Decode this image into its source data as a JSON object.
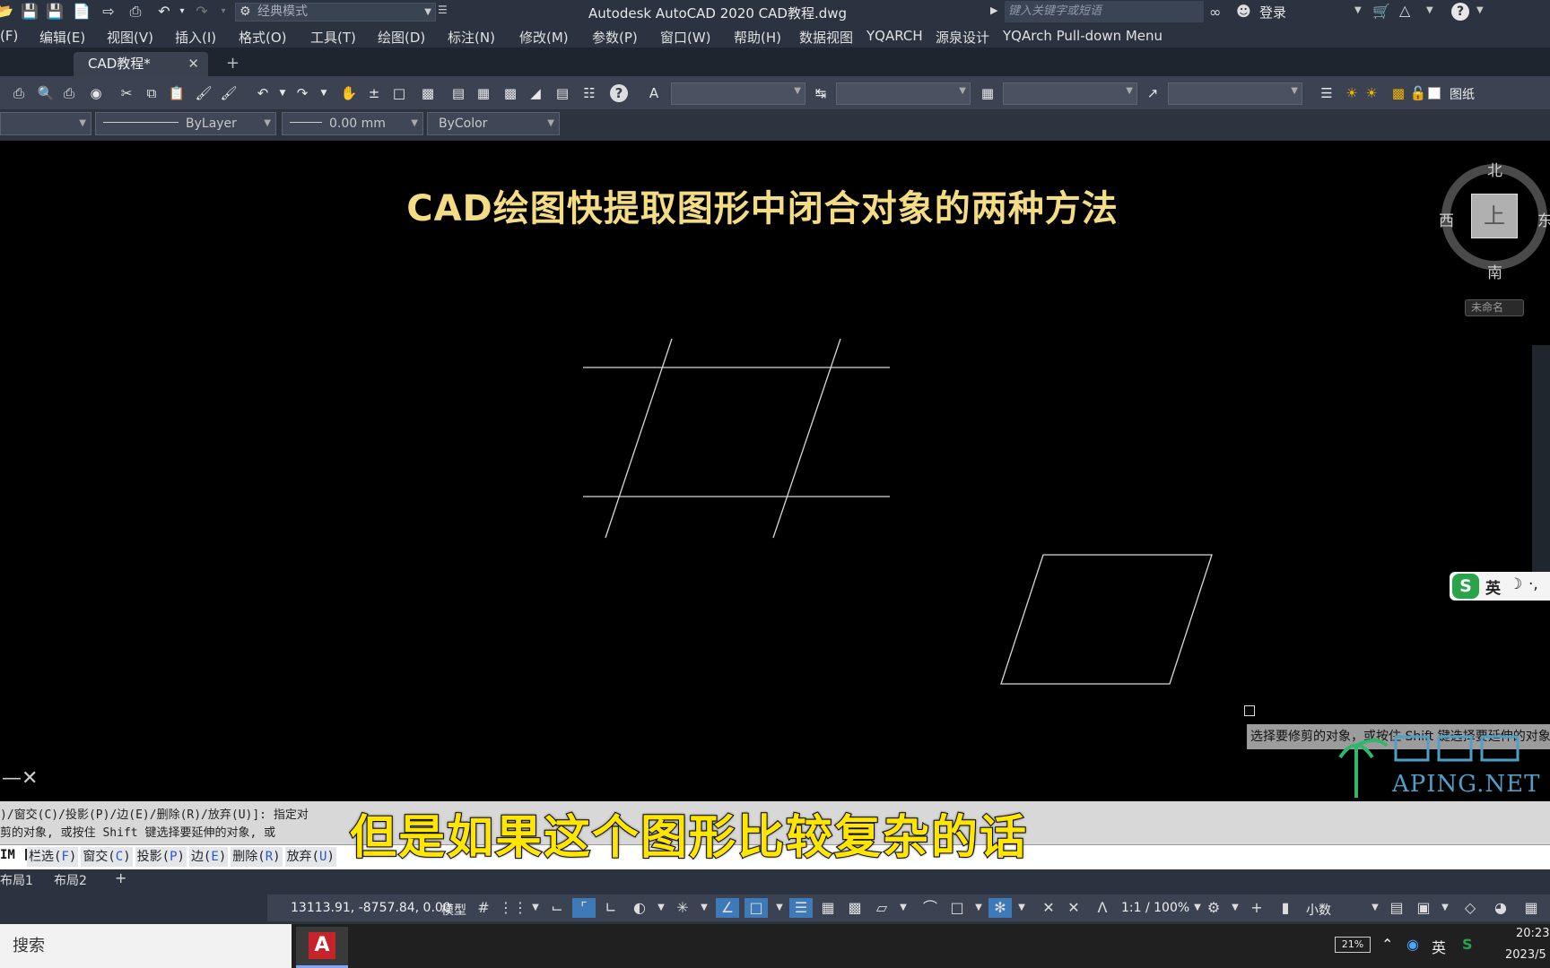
{
  "titlebar": {
    "workspace": "经典模式",
    "app_title": "Autodesk AutoCAD 2020    CAD教程.dwg",
    "search_placeholder": "键入关键字或短语",
    "login": "登录"
  },
  "menus": [
    "(F)",
    "编辑(E)",
    "视图(V)",
    "插入(I)",
    "格式(O)",
    "工具(T)",
    "绘图(D)",
    "标注(N)",
    "修改(M)",
    "参数(P)",
    "窗口(W)",
    "帮助(H)",
    "数据视图",
    "YQARCH",
    "源泉设计",
    "YQArch Pull-down Menu"
  ],
  "tabs": {
    "doc_tab": "CAD教程*",
    "add": "+"
  },
  "toolbar": {
    "drawing_label": "图纸"
  },
  "properties": {
    "linetype": "ByLayer",
    "lineweight": "0.00 mm",
    "color": "ByColor"
  },
  "drawing": {
    "title": "CAD绘图快提取图形中闭合对象的两种方法"
  },
  "viewcube": {
    "north": "北",
    "south": "南",
    "west": "西",
    "east": "东",
    "face": "上",
    "wcs": "未命名"
  },
  "ime": {
    "icon": "S",
    "lang": "英"
  },
  "tooltip": "选择要修剪的对象，或按住 Shift 键选择要延伸的对象",
  "watermark": {
    "text": "APING.NET"
  },
  "command": {
    "history1": ")/窗交(C)/投影(P)/边(E)/删除(R)/放弃(U)]:  指定对",
    "history2": "剪的对象, 或按住 Shift 键选择要延伸的对象, 或",
    "prompt_prefix": "IM [",
    "options": [
      {
        "label": "栏选(",
        "key": "F",
        "end": ")"
      },
      {
        "label": "窗交(",
        "key": "C",
        "end": ")"
      },
      {
        "label": "投影(",
        "key": "P",
        "end": ")"
      },
      {
        "label": "边(",
        "key": "E",
        "end": ")"
      },
      {
        "label": "删除(",
        "key": "R",
        "end": ")"
      },
      {
        "label": "放弃(",
        "key": "U",
        "end": ")"
      }
    ]
  },
  "subtitle": "但是如果这个图形比较复杂的话",
  "layout_tabs": [
    "布局1",
    "布局2",
    "+"
  ],
  "status": {
    "coords": "13113.91, -8757.84, 0.00",
    "model": "模型",
    "anno_scale": "1:1 / 100%",
    "units": "小数"
  },
  "taskbar": {
    "search": "搜索",
    "battery": "21%",
    "lang": "英",
    "time": "20:23",
    "date": "2023/5"
  }
}
